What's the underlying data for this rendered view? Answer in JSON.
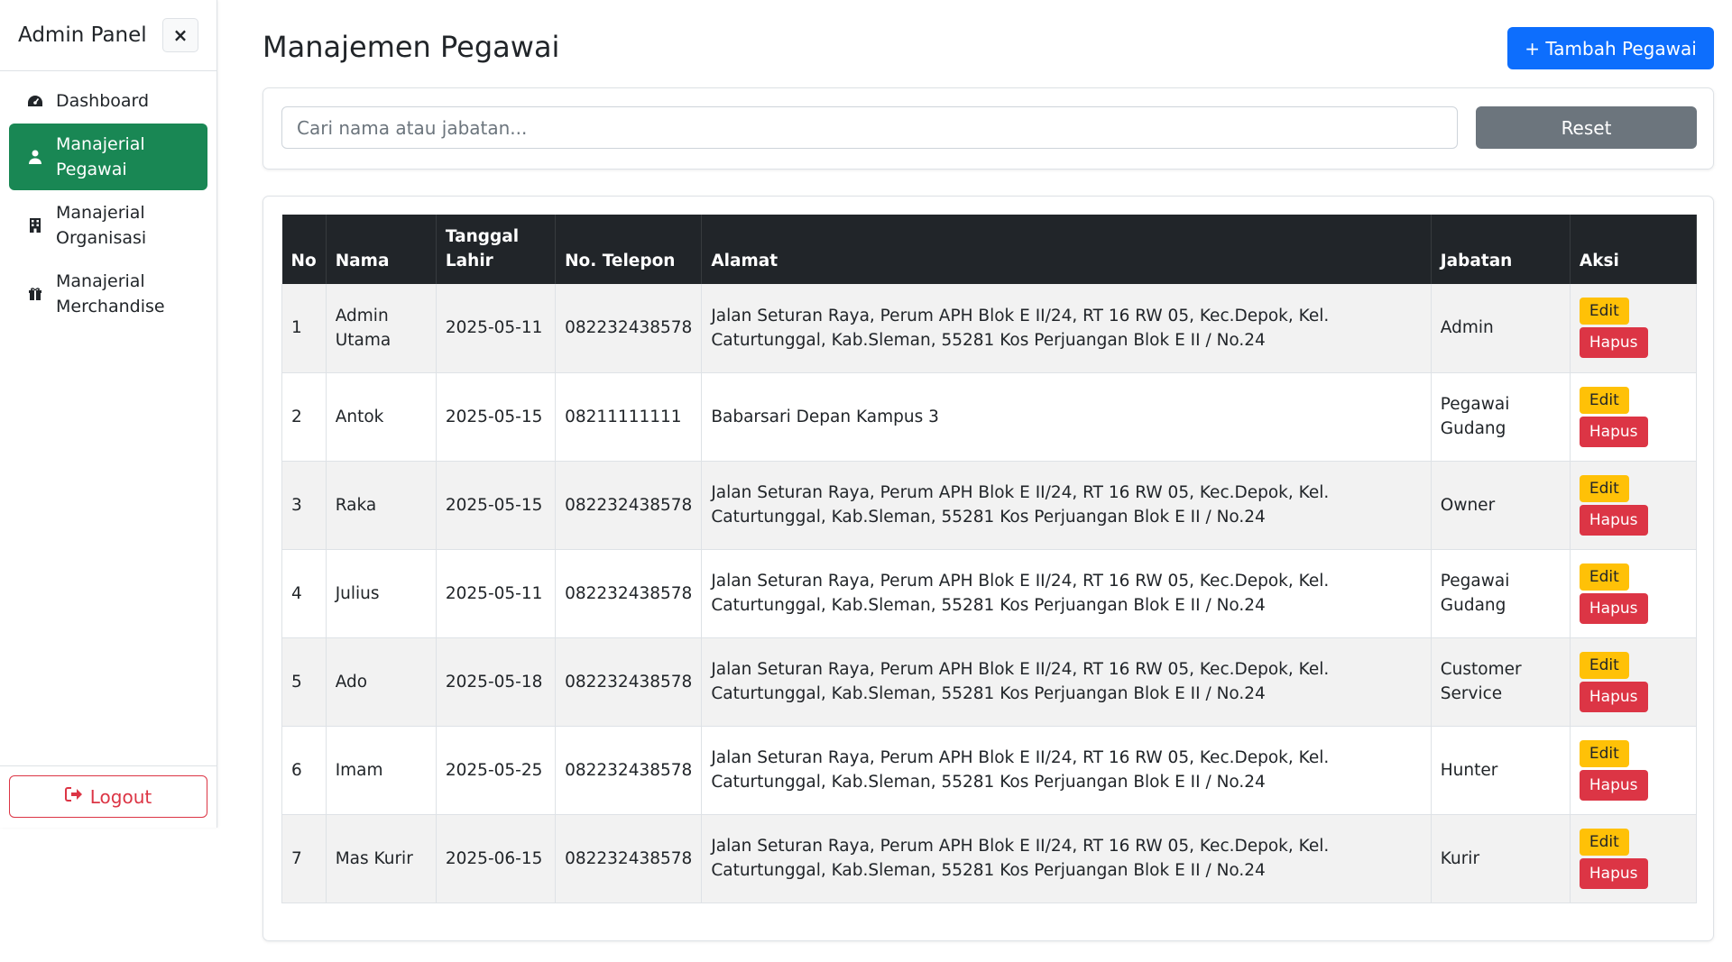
{
  "sidebar": {
    "brand": "Admin Panel",
    "close_label": "×",
    "items": [
      {
        "label": "Dashboard",
        "icon": "dashboard-icon"
      },
      {
        "label": "Manajerial Pegawai",
        "icon": "user-icon"
      },
      {
        "label": "Manajerial Organisasi",
        "icon": "building-icon"
      },
      {
        "label": "Manajerial Merchandise",
        "icon": "gift-icon"
      }
    ],
    "logout_label": "Logout"
  },
  "header": {
    "title": "Manajemen Pegawai",
    "add_button": "+ Tambah Pegawai"
  },
  "search": {
    "placeholder": "Cari nama atau jabatan...",
    "reset_label": "Reset"
  },
  "table": {
    "columns": [
      "No",
      "Nama",
      "Tanggal Lahir",
      "No. Telepon",
      "Alamat",
      "Jabatan",
      "Aksi"
    ],
    "edit_label": "Edit",
    "delete_label": "Hapus",
    "rows": [
      {
        "no": "1",
        "nama": "Admin Utama",
        "tanggal_lahir": "2025-05-11",
        "telepon": "082232438578",
        "alamat": "Jalan Seturan Raya, Perum APH Blok E II/24, RT 16 RW 05, Kec.Depok, Kel. Caturtunggal, Kab.Sleman, 55281 Kos Perjuangan Blok E II / No.24",
        "jabatan": "Admin"
      },
      {
        "no": "2",
        "nama": "Antok",
        "tanggal_lahir": "2025-05-15",
        "telepon": "08211111111",
        "alamat": "Babarsari Depan Kampus 3",
        "jabatan": "Pegawai Gudang"
      },
      {
        "no": "3",
        "nama": "Raka",
        "tanggal_lahir": "2025-05-15",
        "telepon": "082232438578",
        "alamat": "Jalan Seturan Raya, Perum APH Blok E II/24, RT 16 RW 05, Kec.Depok, Kel. Caturtunggal, Kab.Sleman, 55281 Kos Perjuangan Blok E II / No.24",
        "jabatan": "Owner"
      },
      {
        "no": "4",
        "nama": "Julius",
        "tanggal_lahir": "2025-05-11",
        "telepon": "082232438578",
        "alamat": "Jalan Seturan Raya, Perum APH Blok E II/24, RT 16 RW 05, Kec.Depok, Kel. Caturtunggal, Kab.Sleman, 55281 Kos Perjuangan Blok E II / No.24",
        "jabatan": "Pegawai Gudang"
      },
      {
        "no": "5",
        "nama": "Ado",
        "tanggal_lahir": "2025-05-18",
        "telepon": "082232438578",
        "alamat": "Jalan Seturan Raya, Perum APH Blok E II/24, RT 16 RW 05, Kec.Depok, Kel. Caturtunggal, Kab.Sleman, 55281 Kos Perjuangan Blok E II / No.24",
        "jabatan": "Customer Service"
      },
      {
        "no": "6",
        "nama": "Imam",
        "tanggal_lahir": "2025-05-25",
        "telepon": "082232438578",
        "alamat": "Jalan Seturan Raya, Perum APH Blok E II/24, RT 16 RW 05, Kec.Depok, Kel. Caturtunggal, Kab.Sleman, 55281 Kos Perjuangan Blok E II / No.24",
        "jabatan": "Hunter"
      },
      {
        "no": "7",
        "nama": "Mas Kurir",
        "tanggal_lahir": "2025-06-15",
        "telepon": "082232438578",
        "alamat": "Jalan Seturan Raya, Perum APH Blok E II/24, RT 16 RW 05, Kec.Depok, Kel. Caturtunggal, Kab.Sleman, 55281 Kos Perjuangan Blok E II / No.24",
        "jabatan": "Kurir"
      }
    ]
  },
  "colors": {
    "active_nav": "#198754",
    "primary": "#0d6efd",
    "secondary": "#6c757d",
    "warning": "#ffc107",
    "danger": "#dc3545",
    "table_header": "#212529"
  }
}
